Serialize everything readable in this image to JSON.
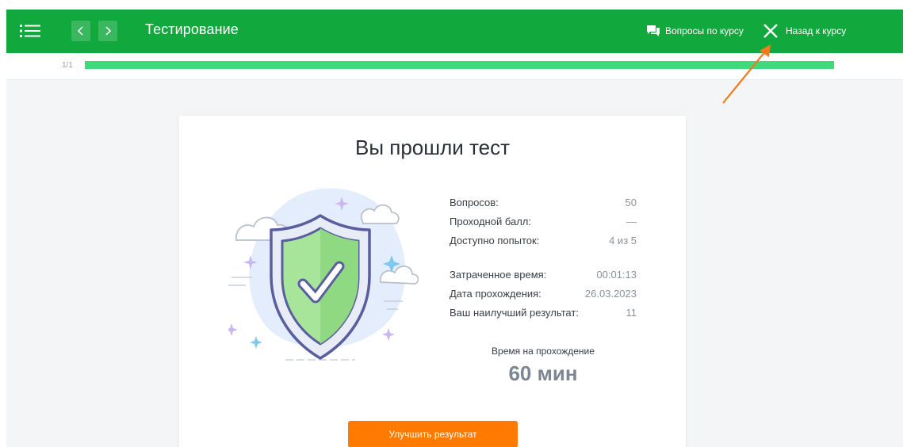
{
  "header": {
    "title": "Тестирование",
    "questions_label": "Вопросы по курсу",
    "back_label": "Назад к курсу",
    "accent_color": "#11a83d",
    "icons": {
      "menu": "menu-list-icon",
      "prev": "chevron-left-icon",
      "next": "chevron-right-icon",
      "questions": "chat-bubbles-icon",
      "back": "close-icon"
    }
  },
  "progress": {
    "label": "1/1",
    "fraction": 1.0,
    "color": "#3ddb7b"
  },
  "result": {
    "title": "Вы прошли тест",
    "stats_group1": [
      {
        "label": "Вопросов:",
        "value": "50"
      },
      {
        "label": "Проходной балл:",
        "value": "—"
      },
      {
        "label": "Доступно попыток:",
        "value": "4 из 5"
      }
    ],
    "stats_group2": [
      {
        "label": "Затраченное время:",
        "value": "00:01:13"
      },
      {
        "label": "Дата прохождения:",
        "value": "26.03.2023"
      },
      {
        "label": "Ваш наилучший результат:",
        "value": "11"
      }
    ],
    "time_caption": "Время на прохождение",
    "time_value": "60 мин",
    "improve_button": "Улучшить результат",
    "button_color": "#ff7a00",
    "illustration_icon": "shield-checkmark-icon"
  }
}
